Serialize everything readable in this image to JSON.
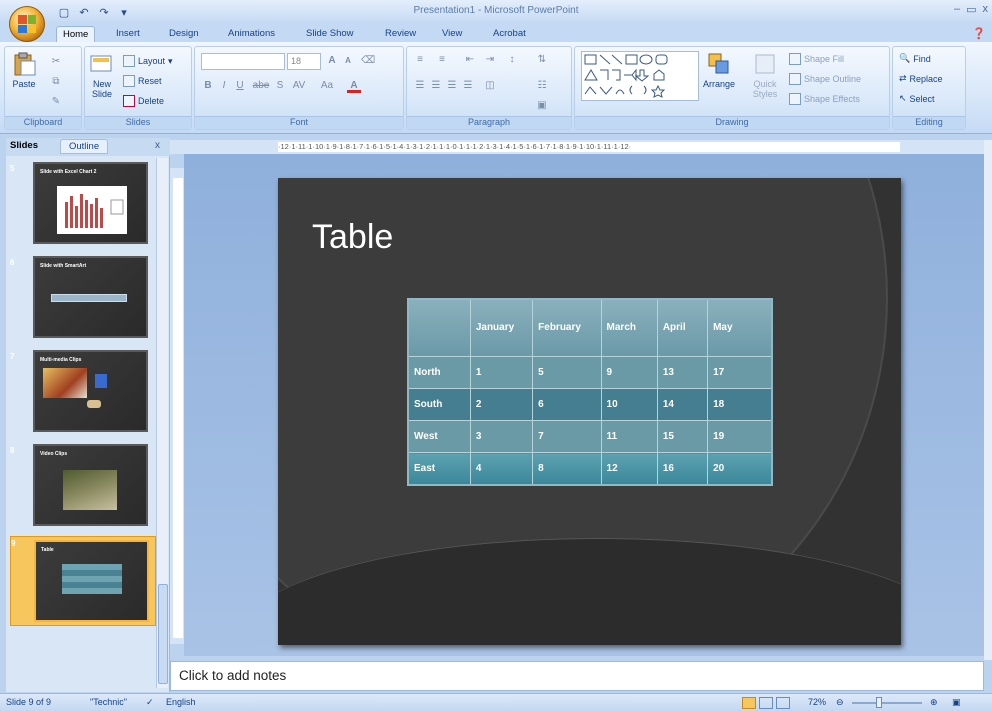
{
  "app": {
    "window_title": "Presentation1 - Microsoft PowerPoint",
    "window_controls": [
      "–",
      "▭",
      "x"
    ]
  },
  "quick_access": [
    "save-icon",
    "undo-icon",
    "redo-icon",
    "customize-icon"
  ],
  "tabs": [
    "Home",
    "Insert",
    "Design",
    "Animations",
    "Slide Show",
    "Review",
    "View",
    "Acrobat"
  ],
  "active_tab": "Home",
  "ribbon": {
    "clipboard": {
      "label": "Clipboard",
      "paste": "Paste"
    },
    "slides": {
      "label": "Slides",
      "new_slide": "New",
      "new_slide2": "Slide",
      "layout": "Layout",
      "reset": "Reset",
      "delete": "Delete"
    },
    "font": {
      "label": "Font",
      "size": "18",
      "bold": "B",
      "italic": "I",
      "underline": "U",
      "strike": "abe",
      "shadow": "S",
      "spacing": "AV",
      "case": "Aa",
      "color": "A"
    },
    "paragraph": {
      "label": "Paragraph"
    },
    "drawing": {
      "label": "Drawing",
      "arrange": "Arrange",
      "quick_styles": "Quick Styles",
      "shape_fill": "Shape Fill",
      "shape_outline": "Shape Outline",
      "shape_effects": "Shape Effects"
    },
    "editing": {
      "label": "Editing",
      "find": "Find",
      "replace": "Replace",
      "select": "Select"
    }
  },
  "ruler_h": "·12·1·11·1·10·1·9·1·8·1·7·1·6·1·5·1·4·1·3·1·2·1·1·1·0·1·1·1·2·1·3·1·4·1·5·1·6·1·7·1·8·1·9·1·10·1·11·1·12·",
  "panel": {
    "tab_slides": "Slides",
    "tab_outline": "Outline",
    "close": "x",
    "thumbnails": [
      {
        "num": "5",
        "title": "Slide with Excel Chart 2"
      },
      {
        "num": "6",
        "title": "Slide with SmartArt"
      },
      {
        "num": "7",
        "title": "Multi-media Clips"
      },
      {
        "num": "8",
        "title": "Video Clips"
      },
      {
        "num": "9",
        "title": "Table"
      }
    ]
  },
  "slide": {
    "title": "Table",
    "table": {
      "headers": [
        "",
        "January",
        "February",
        "March",
        "April",
        "May"
      ],
      "rows": [
        [
          "North",
          "1",
          "5",
          "9",
          "13",
          "17"
        ],
        [
          "South",
          "2",
          "6",
          "10",
          "14",
          "18"
        ],
        [
          "West",
          "3",
          "7",
          "11",
          "15",
          "19"
        ],
        [
          "East",
          "4",
          "8",
          "12",
          "16",
          "20"
        ]
      ]
    }
  },
  "notes_placeholder": "Click to add notes",
  "status": {
    "slide_count": "Slide 9 of 9",
    "theme": "\"Technic\"",
    "language": "English",
    "zoom": "72%"
  },
  "colors": {
    "accent_orange": "#f7b342",
    "ribbon_blue": "#c4d9f4",
    "slide_bg": "#323232",
    "table_teal": "#457e90"
  }
}
